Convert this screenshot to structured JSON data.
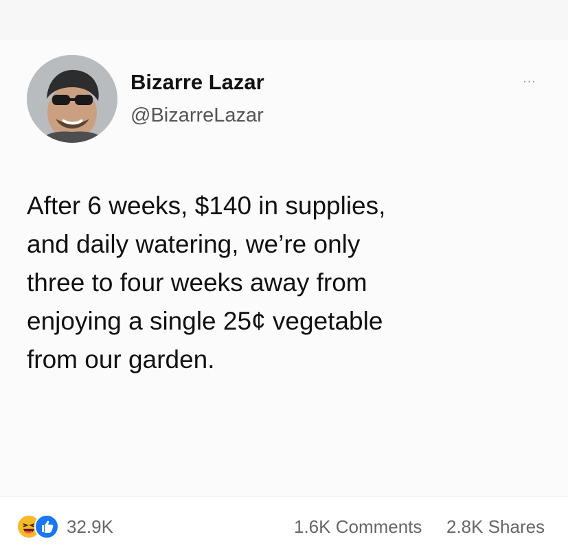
{
  "post": {
    "author_name": "Bizarre Lazar",
    "author_handle": "@BizarreLazar",
    "more_label": "...",
    "text": "After 6 weeks, $140 in supplies,\nand daily watering, we’re only\nthree to four weeks away from\nenjoying a single 25¢ vegetable\nfrom our garden."
  },
  "footer": {
    "reaction_icons": [
      "haha-icon",
      "like-icon"
    ],
    "reaction_count": "32.9K",
    "comments": "1.6K Comments",
    "shares": "2.8K Shares"
  },
  "colors": {
    "like_blue": "#1877f2",
    "haha_yellow": "#f7b928",
    "meta_gray": "#65676b"
  }
}
